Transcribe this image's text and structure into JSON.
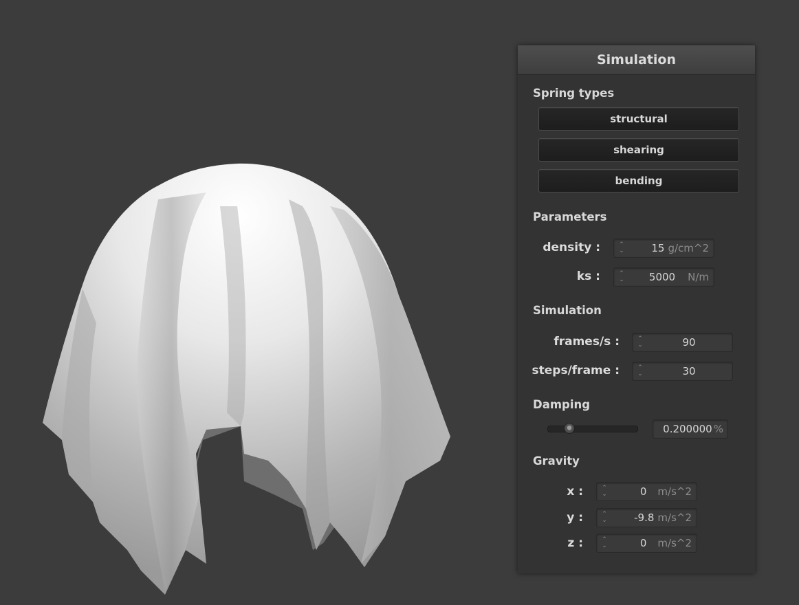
{
  "scene": {
    "object": "cloth-draped-over-sphere"
  },
  "panel": {
    "title": "Simulation",
    "spring_types": {
      "title": "Spring types",
      "buttons": [
        "structural",
        "shearing",
        "bending"
      ]
    },
    "parameters": {
      "title": "Parameters",
      "density": {
        "label": "density :",
        "value": "15",
        "unit": "g/cm^2"
      },
      "ks": {
        "label": "ks :",
        "value": "5000",
        "unit": "N/m"
      }
    },
    "simulation": {
      "title": "Simulation",
      "fps": {
        "label": "frames/s :",
        "value": "90"
      },
      "steps": {
        "label": "steps/frame :",
        "value": "30"
      }
    },
    "damping": {
      "title": "Damping",
      "slider_fraction": 0.2,
      "value": "0.200000",
      "unit": "%"
    },
    "gravity": {
      "title": "Gravity",
      "x": {
        "label": "x :",
        "value": "0",
        "unit": "m/s^2"
      },
      "y": {
        "label": "y :",
        "value": "-9.8",
        "unit": "m/s^2"
      },
      "z": {
        "label": "z :",
        "value": "0",
        "unit": "m/s^2"
      }
    }
  }
}
